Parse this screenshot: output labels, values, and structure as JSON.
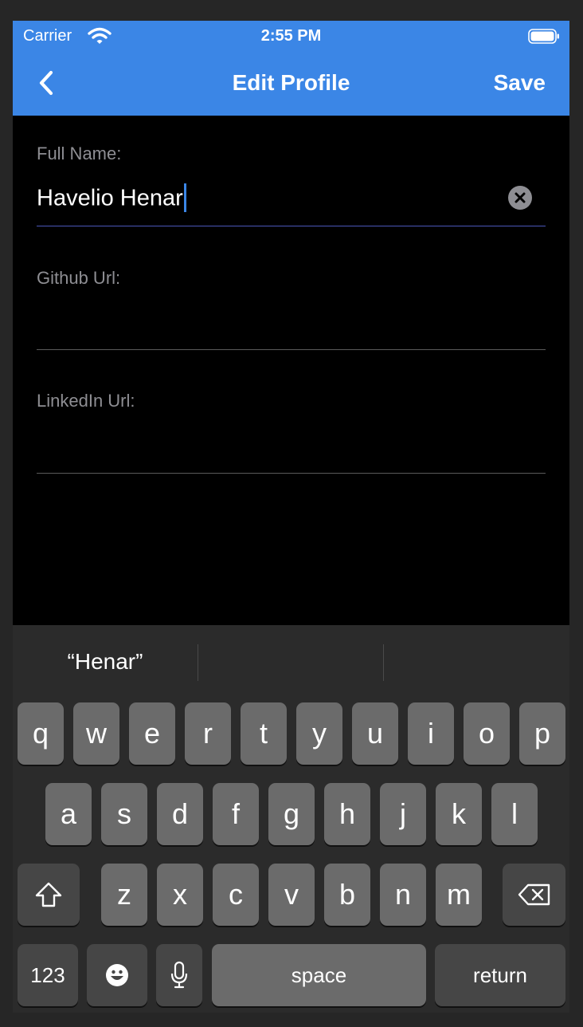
{
  "status_bar": {
    "carrier": "Carrier",
    "time": "2:55 PM"
  },
  "nav": {
    "back_icon": "chevron-left-icon",
    "title": "Edit Profile",
    "save_label": "Save",
    "background": "#3b86e6"
  },
  "form": {
    "full_name": {
      "label": "Full Name:",
      "value": "Havelio Henar"
    },
    "github_url": {
      "label": "Github Url:",
      "value": ""
    },
    "linkedin_url": {
      "label": "LinkedIn Url:",
      "value": ""
    }
  },
  "keyboard": {
    "suggestions": [
      "“Henar”",
      "",
      ""
    ],
    "rows": [
      [
        "q",
        "w",
        "e",
        "r",
        "t",
        "y",
        "u",
        "i",
        "o",
        "p"
      ],
      [
        "a",
        "s",
        "d",
        "f",
        "g",
        "h",
        "j",
        "k",
        "l"
      ],
      [
        "z",
        "x",
        "c",
        "v",
        "b",
        "n",
        "m"
      ]
    ],
    "numbers_label": "123",
    "space_label": "space",
    "return_label": "return"
  },
  "colors": {
    "accent": "#3b86e6",
    "background": "#000000",
    "label_gray": "#8e8e93",
    "key": "#6b6b6b",
    "key_dark": "#464646"
  }
}
